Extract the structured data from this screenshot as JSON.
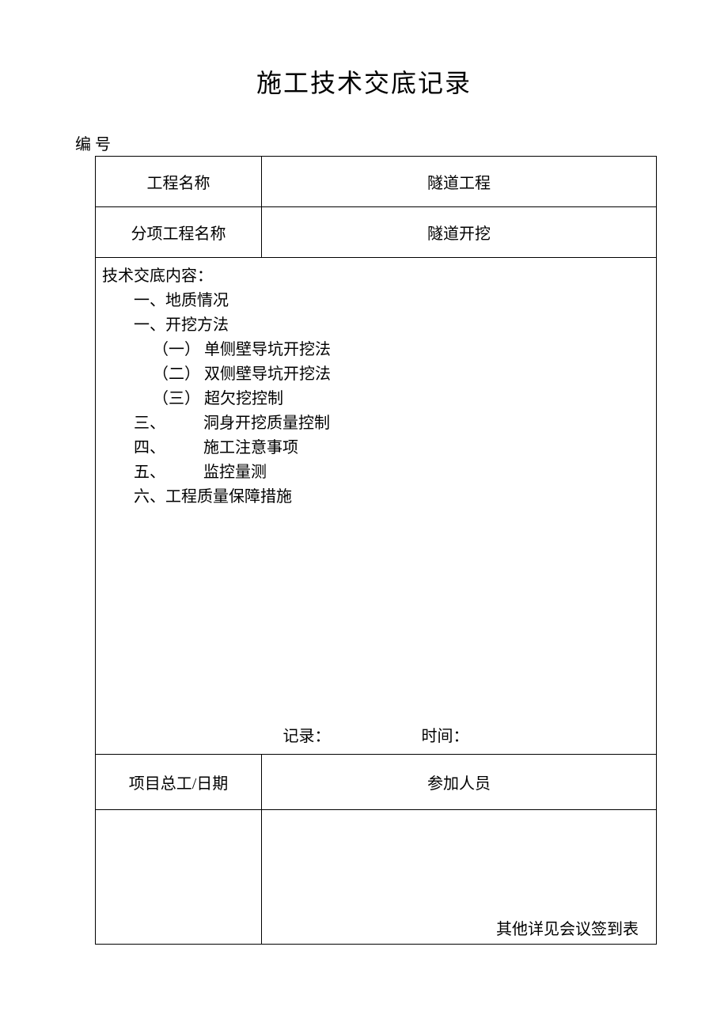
{
  "title": "施工技术交底记录",
  "serial_label": "编 号",
  "row1": {
    "label": "工程名称",
    "value": "隧道工程"
  },
  "row2": {
    "label": "分项工程名称",
    "value": "隧道开挖"
  },
  "content": {
    "heading": "技术交底内容：",
    "items": {
      "i1": "一、地质情况",
      "i2": "一、开挖方法",
      "i2a": "（一） 单侧壁导坑开挖法",
      "i2b": "（二） 双侧壁导坑开挖法",
      "i2c": "（三） 超欠挖控制",
      "i3_num": "三、",
      "i3_text": "洞身开挖质量控制",
      "i4_num": "四、",
      "i4_text": "施工注意事项",
      "i5_num": "五、",
      "i5_text": "监控量测",
      "i6": "六、工程质量保障措施"
    },
    "record_label": "记录：",
    "time_label": "时间："
  },
  "sign": {
    "left_label": "项目总工/日期",
    "right_label": "参加人员",
    "note": "其他详见会议签到表"
  }
}
